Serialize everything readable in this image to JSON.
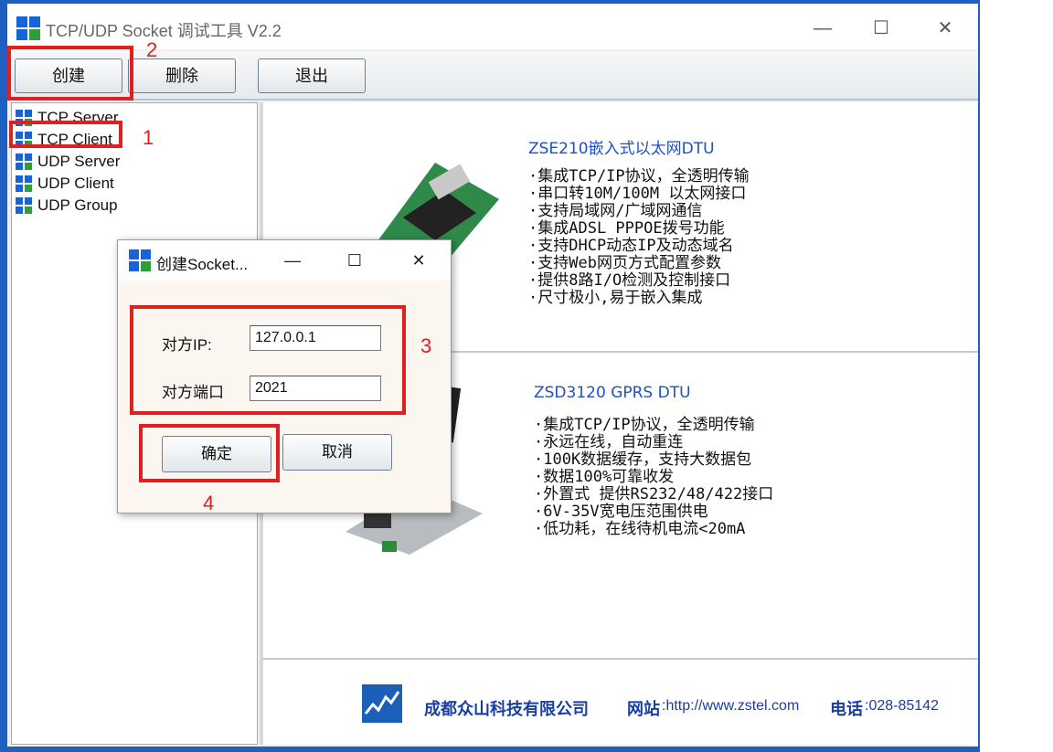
{
  "window": {
    "title": "TCP/UDP Socket 调试工具 V2.2",
    "controls": {
      "minimize": "—",
      "maximize": "☐",
      "close": "✕"
    }
  },
  "toolbar": {
    "create_label": "创建",
    "delete_label": "删除",
    "exit_label": "退出"
  },
  "tree": {
    "items": [
      "TCP Server",
      "TCP Client",
      "UDP Server",
      "UDP Client",
      "UDP Group"
    ]
  },
  "products": [
    {
      "title": "ZSE210嵌入式以太网DTU",
      "features": [
        "·集成TCP/IP协议，全透明传输",
        "·串口转10M/100M 以太网接口",
        "·支持局域网/广域网通信",
        "·集成ADSL PPPOE拨号功能",
        "·支持DHCP动态IP及动态域名",
        "·支持Web网页方式配置参数",
        "·提供8路I/O检测及控制接口",
        "·尺寸极小,易于嵌入集成"
      ]
    },
    {
      "title": "ZSD3120 GPRS DTU",
      "features": [
        "·集成TCP/IP协议，全透明传输",
        "·永远在线，自动重连",
        "·100K数据缓存，支持大数据包",
        "·数据100%可靠收发",
        "·外置式 提供RS232/48/422接口",
        "·6V-35V宽电压范围供电",
        "·低功耗，在线待机电流<20mA"
      ]
    }
  ],
  "footer": {
    "company": "成都众山科技有限公司",
    "website_label": "网站",
    "website": ":http://www.zstel.com",
    "phone_label": "电话",
    "phone": ":028-85142"
  },
  "dialog": {
    "title": "创建Socket...",
    "ip_label": "对方IP:",
    "ip_value": "127.0.0.1",
    "port_label": "对方端口",
    "port_value": "2021",
    "ok_label": "确定",
    "cancel_label": "取消"
  },
  "annotations": {
    "n1": "1",
    "n2": "2",
    "n3": "3",
    "n4": "4",
    "color": "#e02020"
  },
  "colors": {
    "accent_blue": "#1f5fbf",
    "link_blue": "#2050c0"
  }
}
